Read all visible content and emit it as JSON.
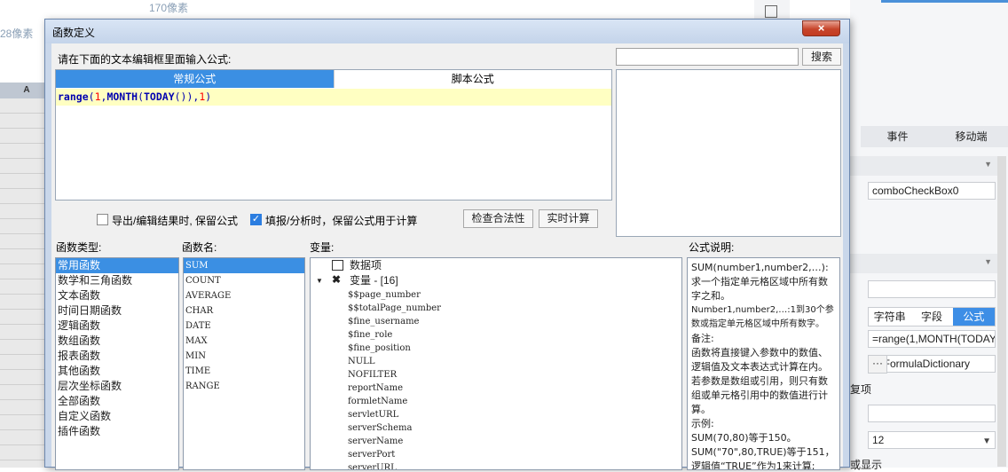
{
  "background": {
    "px_label_top": "170像素",
    "px_label_left": "28像素",
    "grid_col_header": "A",
    "panel_tabs": [
      "事件",
      "移动端"
    ],
    "widget_name": "comboCheckBox0",
    "value_type_tabs": [
      "字符串",
      "字段",
      "公式"
    ],
    "formula_value": "=range(1,MONTH(TODAY",
    "dictionary_value": "pl.FormulaDictionary",
    "dictionary_button": "···",
    "label_repeat": "复项",
    "select_value": "12",
    "label_display": "或显示"
  },
  "dialog": {
    "title": "函数定义",
    "close_label": "×",
    "prompt": "请在下面的文本编辑框里面输入公式:",
    "tabs": [
      "常规公式",
      "脚本公式"
    ],
    "formula_tokens": [
      {
        "t": "range",
        "c": "fn"
      },
      {
        "t": "(",
        "c": "p"
      },
      {
        "t": "1",
        "c": "num"
      },
      {
        "t": ",",
        "c": "p"
      },
      {
        "t": "MONTH",
        "c": "fn"
      },
      {
        "t": "(",
        "c": "p"
      },
      {
        "t": "TODAY",
        "c": "fn"
      },
      {
        "t": "())",
        "c": "p"
      },
      {
        "t": ",",
        "c": "p"
      },
      {
        "t": "1",
        "c": "num"
      },
      {
        "t": ")",
        "c": "p"
      }
    ],
    "search_placeholder": "",
    "search_button": "搜索",
    "checkbox_export": {
      "label": "导出/编辑结果时, 保留公式",
      "checked": false
    },
    "checkbox_fill": {
      "label": "填报/分析时，保留公式用于计算",
      "checked": true
    },
    "check_button": "检查合法性",
    "realtime_button": "实时计算",
    "func_type_label": "函数类型:",
    "func_types": [
      "常用函数",
      "数学和三角函数",
      "文本函数",
      "时间日期函数",
      "逻辑函数",
      "数组函数",
      "报表函数",
      "其他函数",
      "层次坐标函数",
      "全部函数",
      "自定义函数",
      "插件函数"
    ],
    "func_name_label": "函数名:",
    "func_names": [
      "SUM",
      "COUNT",
      "AVERAGE",
      "CHAR",
      "DATE",
      "MAX",
      "MIN",
      "TIME",
      "RANGE"
    ],
    "vars_label": "变量:",
    "vars_data_item": "数据项",
    "vars_group": "变量 - [16]",
    "vars": [
      "$$page_number",
      "$$totalPage_number",
      "$fine_username",
      "$fine_role",
      "$fine_position",
      "NULL",
      "NOFILTER",
      "reportName",
      "formletName",
      "servletURL",
      "serverSchema",
      "serverName",
      "serverPort",
      "serverURL"
    ],
    "desc_label": "公式说明:",
    "desc_lines": [
      "SUM(number1,number2,…):求一个指定单元格区域中所有数字之和。",
      "Number1,number2,…:1到30个参数或指定单元格区域中所有数字。",
      "备注:",
      "函数将直接键入参数中的数值、逻辑值及文本表达式计算在内。若参数是数组或引用，则只有数组或单元格引用中的数值进行计算。",
      "示例:",
      "SUM(70,80)等于150。",
      "SUM(\"70\",80,TRUE)等于151，逻辑值“TRUE”作为1来计算;"
    ]
  }
}
